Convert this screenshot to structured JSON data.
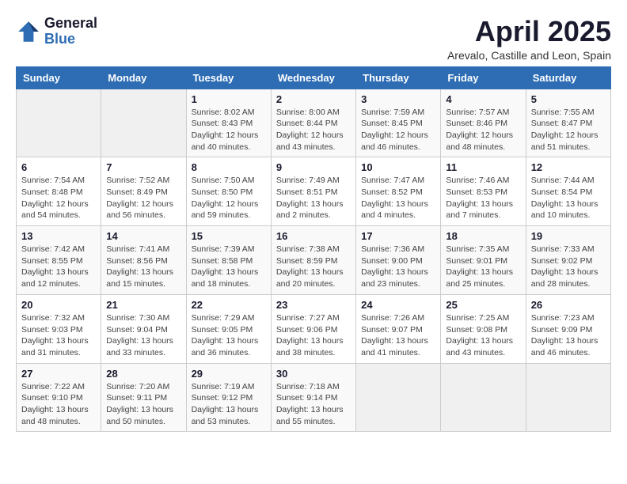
{
  "header": {
    "logo_general": "General",
    "logo_blue": "Blue",
    "title": "April 2025",
    "subtitle": "Arevalo, Castille and Leon, Spain"
  },
  "days_of_week": [
    "Sunday",
    "Monday",
    "Tuesday",
    "Wednesday",
    "Thursday",
    "Friday",
    "Saturday"
  ],
  "weeks": [
    [
      {
        "day": "",
        "info": ""
      },
      {
        "day": "",
        "info": ""
      },
      {
        "day": "1",
        "info": "Sunrise: 8:02 AM\nSunset: 8:43 PM\nDaylight: 12 hours and 40 minutes."
      },
      {
        "day": "2",
        "info": "Sunrise: 8:00 AM\nSunset: 8:44 PM\nDaylight: 12 hours and 43 minutes."
      },
      {
        "day": "3",
        "info": "Sunrise: 7:59 AM\nSunset: 8:45 PM\nDaylight: 12 hours and 46 minutes."
      },
      {
        "day": "4",
        "info": "Sunrise: 7:57 AM\nSunset: 8:46 PM\nDaylight: 12 hours and 48 minutes."
      },
      {
        "day": "5",
        "info": "Sunrise: 7:55 AM\nSunset: 8:47 PM\nDaylight: 12 hours and 51 minutes."
      }
    ],
    [
      {
        "day": "6",
        "info": "Sunrise: 7:54 AM\nSunset: 8:48 PM\nDaylight: 12 hours and 54 minutes."
      },
      {
        "day": "7",
        "info": "Sunrise: 7:52 AM\nSunset: 8:49 PM\nDaylight: 12 hours and 56 minutes."
      },
      {
        "day": "8",
        "info": "Sunrise: 7:50 AM\nSunset: 8:50 PM\nDaylight: 12 hours and 59 minutes."
      },
      {
        "day": "9",
        "info": "Sunrise: 7:49 AM\nSunset: 8:51 PM\nDaylight: 13 hours and 2 minutes."
      },
      {
        "day": "10",
        "info": "Sunrise: 7:47 AM\nSunset: 8:52 PM\nDaylight: 13 hours and 4 minutes."
      },
      {
        "day": "11",
        "info": "Sunrise: 7:46 AM\nSunset: 8:53 PM\nDaylight: 13 hours and 7 minutes."
      },
      {
        "day": "12",
        "info": "Sunrise: 7:44 AM\nSunset: 8:54 PM\nDaylight: 13 hours and 10 minutes."
      }
    ],
    [
      {
        "day": "13",
        "info": "Sunrise: 7:42 AM\nSunset: 8:55 PM\nDaylight: 13 hours and 12 minutes."
      },
      {
        "day": "14",
        "info": "Sunrise: 7:41 AM\nSunset: 8:56 PM\nDaylight: 13 hours and 15 minutes."
      },
      {
        "day": "15",
        "info": "Sunrise: 7:39 AM\nSunset: 8:58 PM\nDaylight: 13 hours and 18 minutes."
      },
      {
        "day": "16",
        "info": "Sunrise: 7:38 AM\nSunset: 8:59 PM\nDaylight: 13 hours and 20 minutes."
      },
      {
        "day": "17",
        "info": "Sunrise: 7:36 AM\nSunset: 9:00 PM\nDaylight: 13 hours and 23 minutes."
      },
      {
        "day": "18",
        "info": "Sunrise: 7:35 AM\nSunset: 9:01 PM\nDaylight: 13 hours and 25 minutes."
      },
      {
        "day": "19",
        "info": "Sunrise: 7:33 AM\nSunset: 9:02 PM\nDaylight: 13 hours and 28 minutes."
      }
    ],
    [
      {
        "day": "20",
        "info": "Sunrise: 7:32 AM\nSunset: 9:03 PM\nDaylight: 13 hours and 31 minutes."
      },
      {
        "day": "21",
        "info": "Sunrise: 7:30 AM\nSunset: 9:04 PM\nDaylight: 13 hours and 33 minutes."
      },
      {
        "day": "22",
        "info": "Sunrise: 7:29 AM\nSunset: 9:05 PM\nDaylight: 13 hours and 36 minutes."
      },
      {
        "day": "23",
        "info": "Sunrise: 7:27 AM\nSunset: 9:06 PM\nDaylight: 13 hours and 38 minutes."
      },
      {
        "day": "24",
        "info": "Sunrise: 7:26 AM\nSunset: 9:07 PM\nDaylight: 13 hours and 41 minutes."
      },
      {
        "day": "25",
        "info": "Sunrise: 7:25 AM\nSunset: 9:08 PM\nDaylight: 13 hours and 43 minutes."
      },
      {
        "day": "26",
        "info": "Sunrise: 7:23 AM\nSunset: 9:09 PM\nDaylight: 13 hours and 46 minutes."
      }
    ],
    [
      {
        "day": "27",
        "info": "Sunrise: 7:22 AM\nSunset: 9:10 PM\nDaylight: 13 hours and 48 minutes."
      },
      {
        "day": "28",
        "info": "Sunrise: 7:20 AM\nSunset: 9:11 PM\nDaylight: 13 hours and 50 minutes."
      },
      {
        "day": "29",
        "info": "Sunrise: 7:19 AM\nSunset: 9:12 PM\nDaylight: 13 hours and 53 minutes."
      },
      {
        "day": "30",
        "info": "Sunrise: 7:18 AM\nSunset: 9:14 PM\nDaylight: 13 hours and 55 minutes."
      },
      {
        "day": "",
        "info": ""
      },
      {
        "day": "",
        "info": ""
      },
      {
        "day": "",
        "info": ""
      }
    ]
  ]
}
